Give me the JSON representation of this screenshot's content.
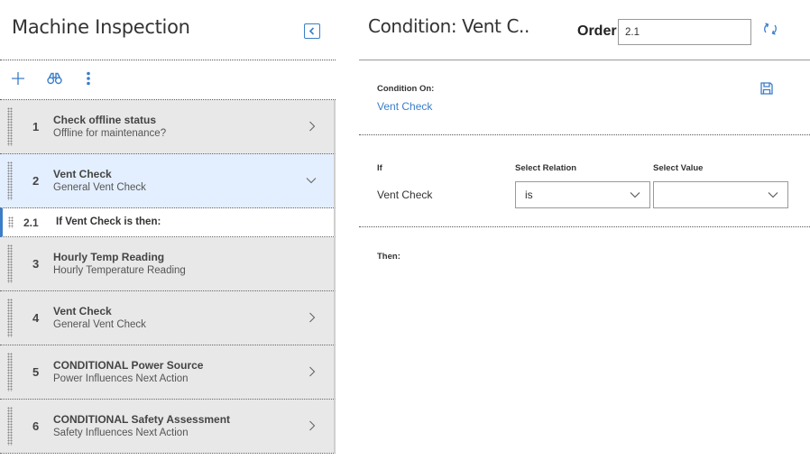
{
  "left_panel": {
    "title": "Machine Inspection",
    "steps": [
      {
        "number": "1",
        "title": "Check offline status",
        "subtitle": "Offline for maintenance?",
        "chevron": "right"
      },
      {
        "number": "2",
        "title": "Vent Check",
        "subtitle": "General Vent Check",
        "chevron": "down",
        "active": true
      },
      {
        "number": "2.1",
        "title": "If Vent Check is then:",
        "sub": true
      },
      {
        "number": "3",
        "title": "Hourly Temp Reading",
        "subtitle": "Hourly Temperature Reading",
        "chevron": "none"
      },
      {
        "number": "4",
        "title": "Vent Check",
        "subtitle": "General Vent Check",
        "chevron": "right"
      },
      {
        "number": "5",
        "title": "CONDITIONAL Power Source",
        "subtitle": "Power Influences Next Action",
        "chevron": "right"
      },
      {
        "number": "6",
        "title": "CONDITIONAL Safety Assessment",
        "subtitle": "Safety Influences Next Action",
        "chevron": "right"
      }
    ]
  },
  "right_panel": {
    "title": "Condition: Vent C..",
    "order_label": "Order",
    "order_value": "2.1",
    "condition_on_label": "Condition On:",
    "condition_on_value": "Vent Check",
    "if_label": "If",
    "select_relation_label": "Select Relation",
    "select_value_label": "Select Value",
    "if_field": "Vent Check",
    "relation_value": "is",
    "select_value": "",
    "then_label": "Then:"
  },
  "colors": {
    "accent": "#3a7dc9",
    "row_bg": "#e8e8e8",
    "row_active_bg": "#e3efff"
  }
}
